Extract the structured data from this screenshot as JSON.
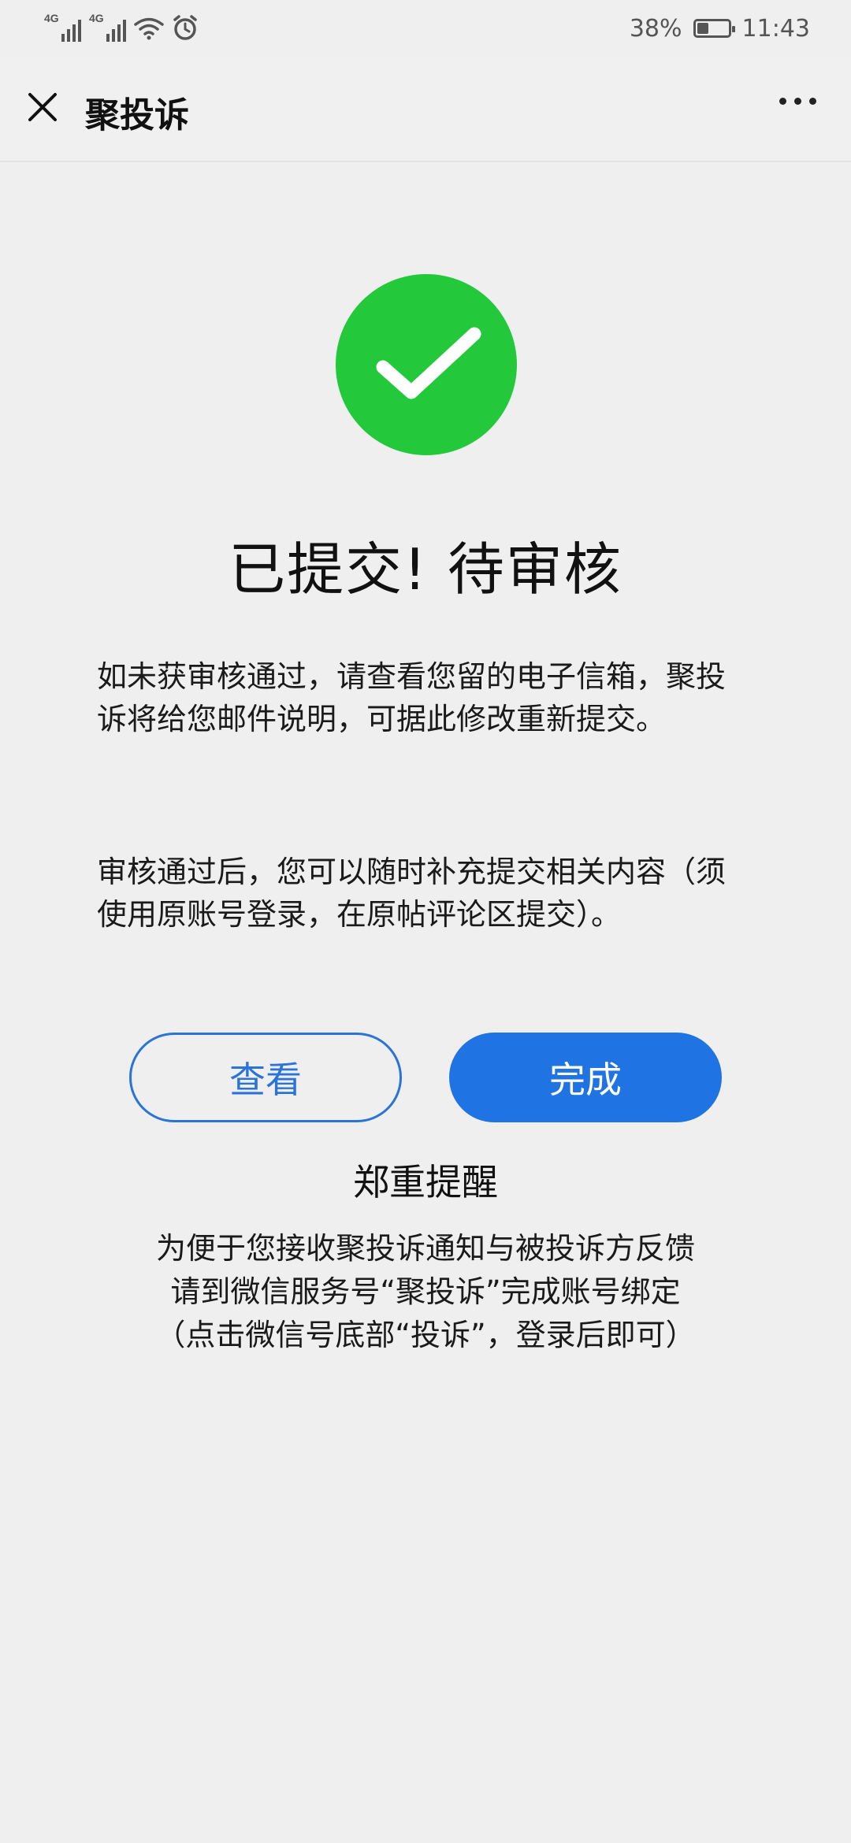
{
  "status_bar": {
    "signal_1_label": "4G",
    "signal_2_label": "4G",
    "battery_text": "38%",
    "battery_level": 0.38,
    "time": "11:43"
  },
  "nav": {
    "title": "聚投诉"
  },
  "result": {
    "headline": "已提交! 待审核",
    "paragraph_1": "如未获审核通过，请查看您留的电子信箱，聚投诉将给您邮件说明，可据此修改重新提交。",
    "paragraph_2": "审核通过后，您可以随时补充提交相关内容（须使用原账号登录，在原帖评论区提交）。"
  },
  "actions": {
    "view_label": "查看",
    "done_label": "完成"
  },
  "reminder": {
    "title": "郑重提醒",
    "lines": [
      "为便于您接收聚投诉通知与被投诉方反馈",
      "请到微信服务号“聚投诉”完成账号绑定",
      "（点击微信号底部“投诉”，登录后即可）"
    ]
  },
  "colors": {
    "success_green": "#23c93a",
    "primary_blue": "#1f73e2",
    "background": "#efefef"
  },
  "icons": {
    "close": "close-icon",
    "more": "more-icon",
    "success": "checkmark-icon",
    "wifi": "wifi-icon",
    "alarm": "alarm-icon"
  }
}
